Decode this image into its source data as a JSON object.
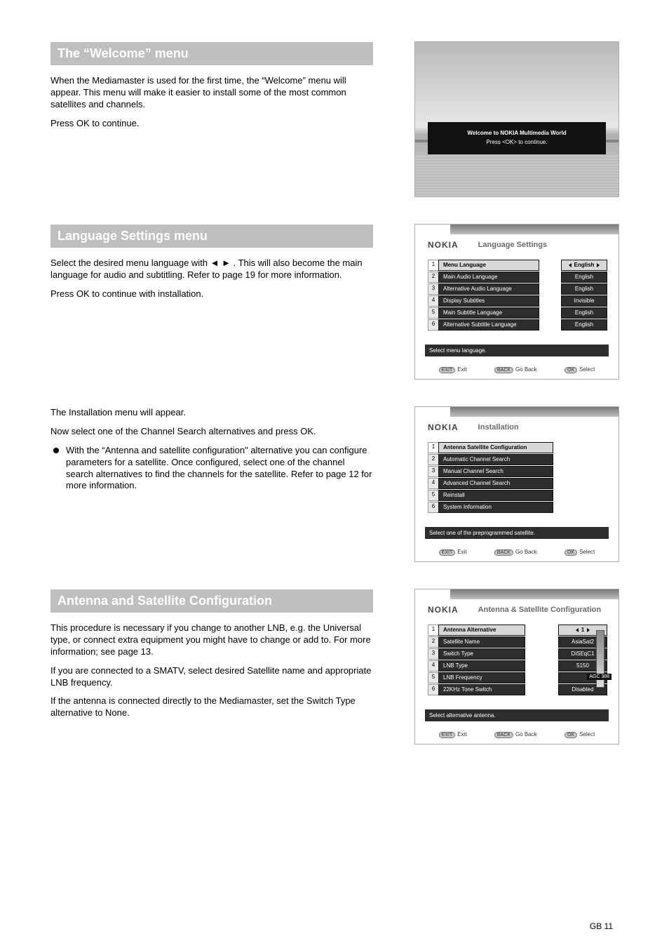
{
  "sections": {
    "welcome": {
      "title": "The “Welcome” menu",
      "paragraphs": [
        "When the Mediamaster is used for the first time, the “Welcome” menu will appear. This menu will make it easier to install some of the most common satellites and channels.",
        "Press OK to continue."
      ],
      "overlay": {
        "line1": "Welcome to NOKIA Multimedia World",
        "line2": "Press <OK> to continue."
      }
    },
    "language": {
      "title": "Language Settings menu",
      "paragraphs": [
        "Select the desired menu language with ◄ ► . This will also become the main language for audio and subtitling. Refer to page 19 for more information.",
        "Press OK to continue with installation."
      ]
    },
    "installation": {
      "paragraphs": [
        "The Installation menu will appear.",
        "Now select one of the Channel Search alternatives and press OK."
      ],
      "bullet": "With the “Antenna and satellite configuration\" alternative you can configure parameters for a satellite. Once configured, select one of the channel search alternatives to find the channels for the satellite. Refer to page 12 for more information."
    },
    "antenna": {
      "title": "Antenna and Satellite Configuration",
      "paragraphs": [
        "This procedure is necessary if you change to another LNB, e.g. the Universal type, or connect extra equipment you might have to change or add to. For more information; see page 13.",
        "If you are connected to a SMATV, select desired Satellite name and appropriate LNB frequency.",
        "If the antenna is connected directly to the Mediamaster, set the Switch Type alternative to None."
      ]
    }
  },
  "screenshots": {
    "brand": "NOKIA",
    "lang": {
      "title": "Language Settings",
      "rows": [
        {
          "n": 1,
          "label": "Menu Language",
          "value": "English",
          "active": true
        },
        {
          "n": 2,
          "label": "Main Audio Language",
          "value": "English"
        },
        {
          "n": 3,
          "label": "Alternative Audio Language",
          "value": "English"
        },
        {
          "n": 4,
          "label": "Display Subtitles",
          "value": "Invisible"
        },
        {
          "n": 5,
          "label": "Main Subtitle Language",
          "value": "English"
        },
        {
          "n": 6,
          "label": "Alternative Subtitle Language",
          "value": "English"
        }
      ],
      "hint": "Select menu language."
    },
    "inst": {
      "title": "Installation",
      "rows": [
        {
          "n": 1,
          "label": "Antenna Satellite Configuration",
          "active": true
        },
        {
          "n": 2,
          "label": "Automatic Channel Search"
        },
        {
          "n": 3,
          "label": "Manual Channel Search"
        },
        {
          "n": 4,
          "label": "Advanced Channel Search"
        },
        {
          "n": 5,
          "label": "Reinstall"
        },
        {
          "n": 6,
          "label": "System Information"
        }
      ],
      "hint": "Select one of the preprogrammed satellite."
    },
    "ant": {
      "title": "Antenna & Satellite Configuration",
      "rows": [
        {
          "n": 1,
          "label": "Antenna Alternative",
          "value": "1",
          "active": true
        },
        {
          "n": 2,
          "label": "Satellite Name",
          "value": "AsiaSat2"
        },
        {
          "n": 3,
          "label": "Switch Type",
          "value": "DiSEqC1"
        },
        {
          "n": 4,
          "label": "LNB Type",
          "value": "5150"
        },
        {
          "n": 5,
          "label": "LNB Frequency",
          "value": ""
        },
        {
          "n": 6,
          "label": "22KHz Tone Switch",
          "value": "Disabled"
        }
      ],
      "hint": "Select alternative antenna.",
      "agc": "AGC 388"
    },
    "footer": {
      "exit": {
        "pill": "EXIT",
        "label": "Exit"
      },
      "back": {
        "pill": "BACK",
        "label": "Go Back"
      },
      "select": {
        "pill": "OK",
        "label": "Select"
      }
    }
  },
  "pageNumber": "GB 11"
}
